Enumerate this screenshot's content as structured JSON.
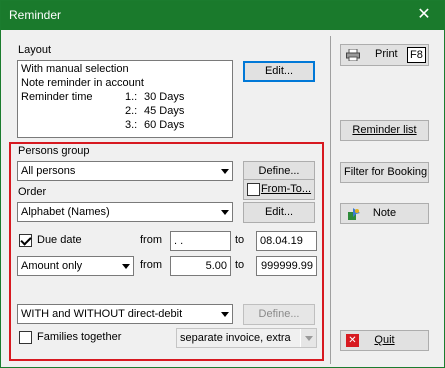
{
  "window": {
    "title": "Reminder",
    "close_glyph": "✕"
  },
  "layout": {
    "label": "Layout",
    "lines": [
      "With manual selection",
      "Note reminder in account"
    ],
    "reminder_time_label": "Reminder time",
    "reminders": [
      {
        "n": "1.:",
        "text": "30 Days"
      },
      {
        "n": "2.:",
        "text": "45 Days"
      },
      {
        "n": "3.:",
        "text": "60 Days"
      }
    ],
    "edit_button": "Edit..."
  },
  "persons_group": {
    "label": "Persons group",
    "value": "All persons",
    "define_button": "Define...",
    "from_to_label": "From-To..."
  },
  "order": {
    "label": "Order",
    "value": "Alphabet (Names)",
    "edit_button": "Edit..."
  },
  "due_date": {
    "checkbox_label": "Due date",
    "checked": true,
    "from_label": "from",
    "from_value": " .  .",
    "to_label": "to",
    "to_value": "08.04.19"
  },
  "amount": {
    "mode": "Amount only",
    "from_label": "from",
    "from_value": "5.00",
    "to_label": "to",
    "to_value": "999999.99"
  },
  "debit": {
    "value": "WITH and WITHOUT direct-debit",
    "define_button": "Define..."
  },
  "families": {
    "checkbox_label": "Families together",
    "checked": false,
    "invoice_value": "separate invoice, extra"
  },
  "side": {
    "print_label": "Print",
    "print_key": "F8",
    "reminder_list": "Reminder list",
    "filter_booking": "Filter for Booking",
    "note": "Note",
    "quit": "Quit"
  },
  "colors": {
    "titlebar": "#1a7a2c",
    "highlight_border": "#d71920",
    "focus": "#0078d7"
  }
}
